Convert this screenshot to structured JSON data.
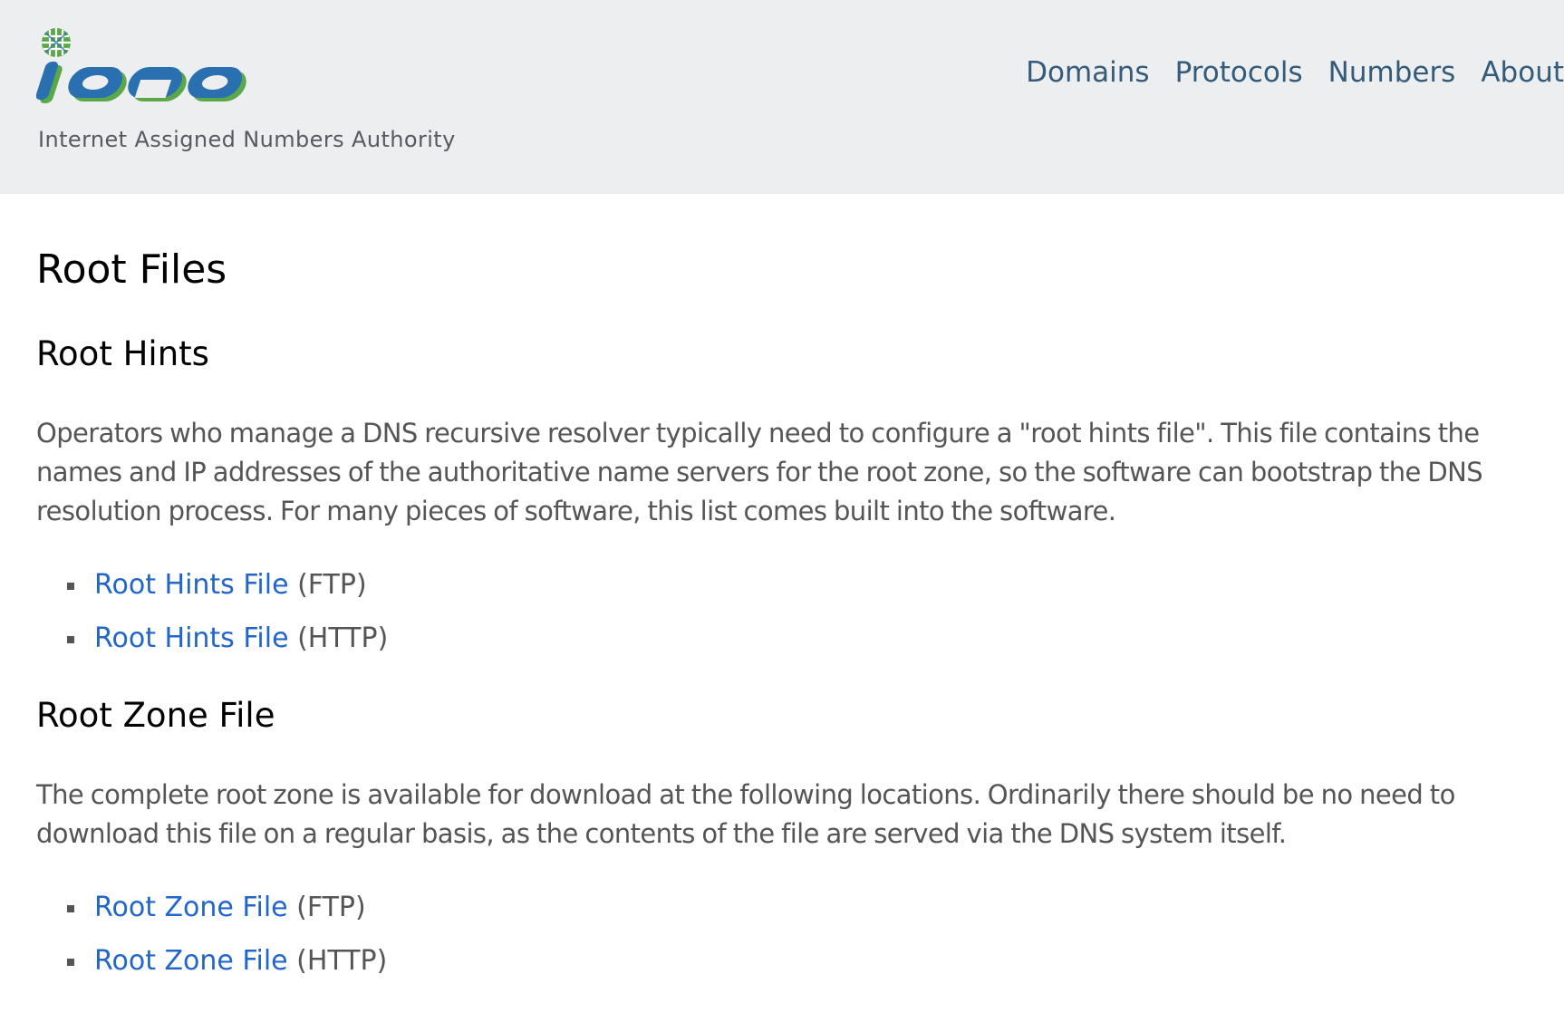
{
  "header": {
    "logo_text": "iana",
    "tagline": "Internet Assigned Numbers Authority",
    "nav": [
      "Domains",
      "Protocols",
      "Numbers",
      "About"
    ],
    "colors": {
      "background": "#eceeef",
      "nav": "#355b7a",
      "logo_blue": "#2a6fb0",
      "logo_green": "#5aa84a"
    }
  },
  "main": {
    "title": "Root Files",
    "sections": [
      {
        "heading": "Root Hints",
        "paragraph": "Operators who manage a DNS recursive resolver typically need to configure a \"root hints file\". This file contains the names and IP addresses of the authoritative name servers for the root zone, so the software can bootstrap the DNS resolution process. For many pieces of software, this list comes built into the software.",
        "links": [
          {
            "label": "Root Hints File",
            "suffix": "(FTP)"
          },
          {
            "label": "Root Hints File",
            "suffix": "(HTTP)"
          }
        ]
      },
      {
        "heading": "Root Zone File",
        "paragraph": "The complete root zone is available for download at the following locations. Ordinarily there should be no need to download this file on a regular basis, as the contents of the file are served via the DNS system itself.",
        "links": [
          {
            "label": "Root Zone File",
            "suffix": "(FTP)"
          },
          {
            "label": "Root Zone File",
            "suffix": "(HTTP)"
          }
        ]
      }
    ],
    "colors": {
      "link": "#2266cc",
      "body_text": "#555555"
    }
  }
}
